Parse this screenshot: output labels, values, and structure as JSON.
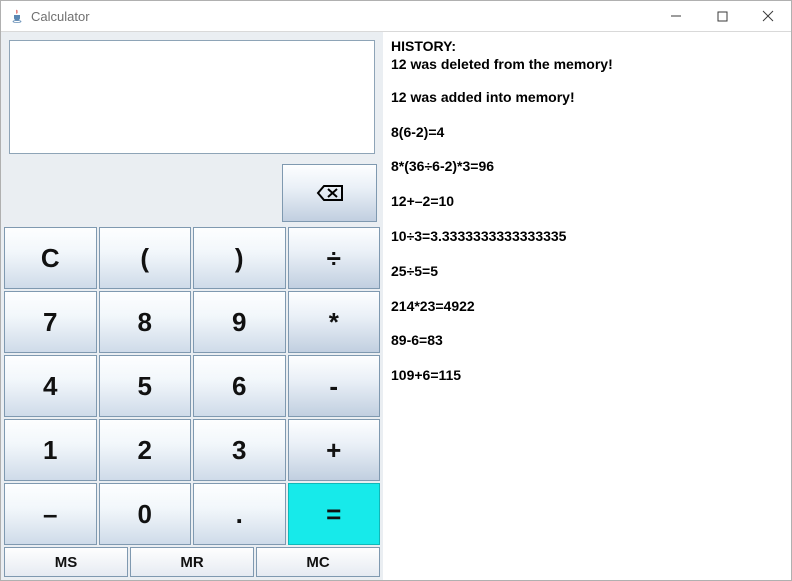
{
  "window": {
    "title": "Calculator",
    "display_value": ""
  },
  "buttons": {
    "backspace_aria": "Backspace",
    "clear": "C",
    "lparen": "(",
    "rparen": ")",
    "divide": "÷",
    "seven": "7",
    "eight": "8",
    "nine": "9",
    "mult": "*",
    "four": "4",
    "five": "5",
    "six": "6",
    "minus": "-",
    "one": "1",
    "two": "2",
    "three": "3",
    "plus": "+",
    "neg": "–",
    "zero": "0",
    "dot": ".",
    "equals": "=",
    "ms": "MS",
    "mr": "MR",
    "mc": "MC"
  },
  "history": {
    "title": "HISTORY:",
    "entries": [
      "12 was deleted from the memory!",
      "12 was added into memory!",
      "8(6-2)=4",
      "8*(36÷6-2)*3=96",
      "12+–2=10",
      "10÷3=3.3333333333333335",
      "25÷5=5",
      "214*23=4922",
      "89-6=83",
      "109+6=115"
    ]
  }
}
